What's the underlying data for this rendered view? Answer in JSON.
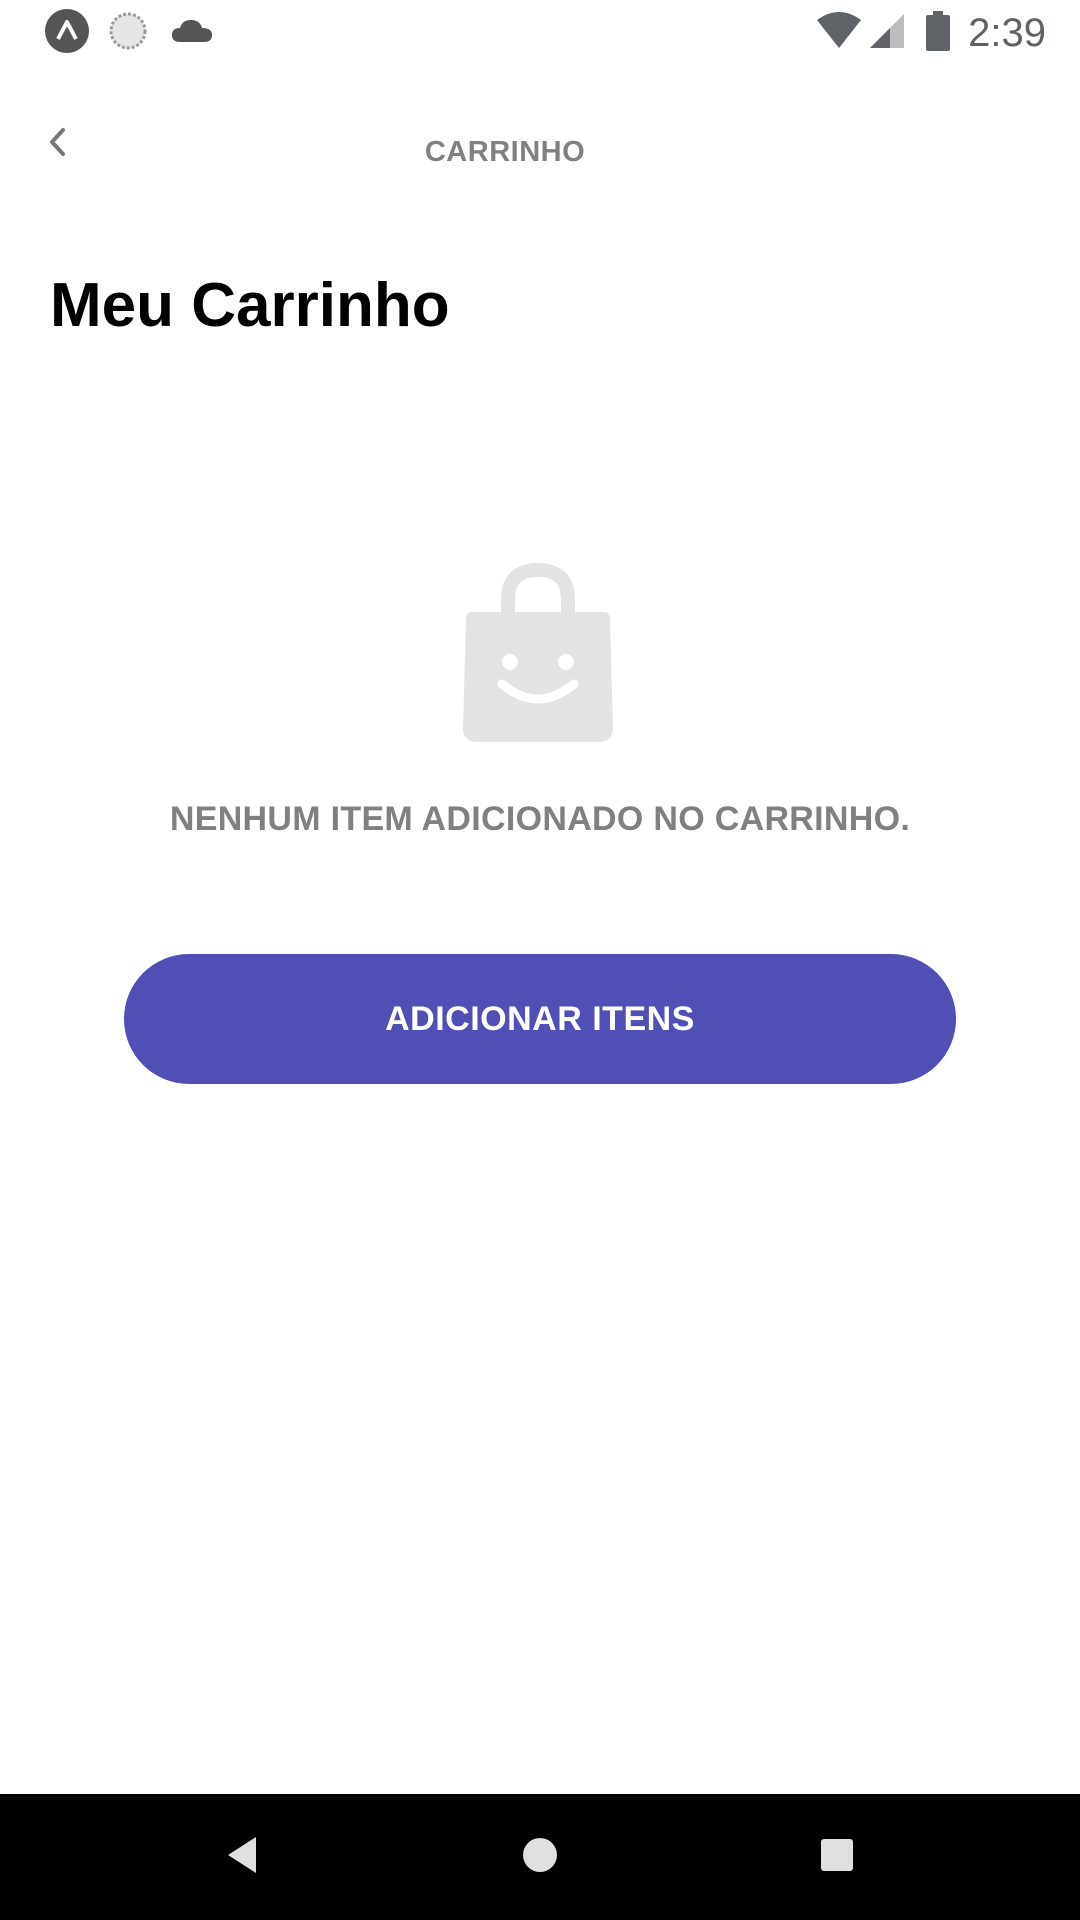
{
  "status_bar": {
    "time": "2:39",
    "left_icons": [
      "expo-icon",
      "sync-icon",
      "cloud-icon"
    ],
    "right_icons": [
      "wifi-icon",
      "cell-signal-icon",
      "battery-icon"
    ]
  },
  "app_bar": {
    "back_icon": "chevron-left-icon",
    "title": "CARRINHO"
  },
  "page": {
    "title": "Meu Carrinho"
  },
  "empty_state": {
    "icon": "shopping-bag-smile-icon",
    "message": "NENHUM ITEM ADICIONADO NO CARRINHO."
  },
  "actions": {
    "add_items_label": "ADICIONAR ITENS"
  },
  "nav_bar": {
    "buttons": [
      "back-triangle-icon",
      "home-circle-icon",
      "recents-square-icon"
    ]
  },
  "colors": {
    "primary": "#4f4fb5",
    "muted_text": "#808080",
    "icon_gray": "#e3e3e3",
    "title_text": "#000000",
    "nav_bar_bg": "#000000"
  }
}
